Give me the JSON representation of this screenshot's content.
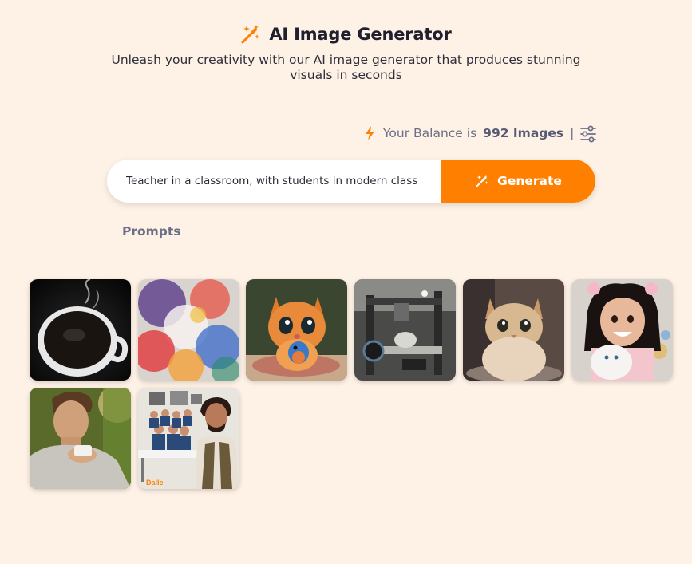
{
  "header": {
    "title": "AI Image Generator",
    "subtitle": "Unleash your creativity with our AI image generator that produces stunning visuals in seconds",
    "icon": "magic-wand-icon"
  },
  "balance": {
    "prefix": "Your Balance is",
    "count": "992 Images",
    "separator": "|",
    "icon": "lightning-bolt-icon",
    "settings_icon": "sliders-icon"
  },
  "prompt": {
    "value": "Teacher in a classroom, with students in modern class",
    "generate_label": "Generate"
  },
  "prompts_label": "Prompts",
  "gallery": {
    "items": [
      "coffee-cup-image",
      "abstract-paint-image",
      "cartoon-cat-bird-image",
      "3d-printer-image",
      "fluffy-cat-image",
      "girl-with-cat-image",
      "man-with-cup-image",
      "teacher-classroom-image"
    ],
    "watermark": "Dalle"
  },
  "colors": {
    "background": "#fef1e5",
    "accent": "#ff8000",
    "muted_text": "#6b6f86"
  }
}
